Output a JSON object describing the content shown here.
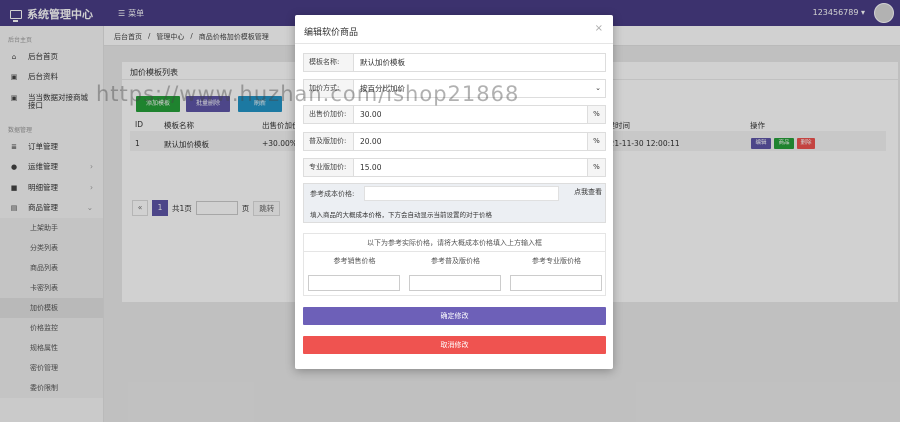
{
  "header": {
    "title": "系统管理中心",
    "menu_label": "菜单",
    "user": "123456789"
  },
  "sidebar": {
    "group1": "后台主页",
    "items1": [
      {
        "label": "后台首页"
      },
      {
        "label": "后台资料"
      },
      {
        "label": "当当数据对接商城接口"
      }
    ],
    "group2": "数据管理",
    "items2": [
      {
        "label": "订单管理"
      },
      {
        "label": "运维管理"
      },
      {
        "label": "明细管理"
      },
      {
        "label": "商品管理"
      }
    ],
    "subitems": [
      {
        "label": "上架助手"
      },
      {
        "label": "分类列表"
      },
      {
        "label": "商品列表"
      },
      {
        "label": "卡密列表"
      },
      {
        "label": "加价模板"
      },
      {
        "label": "价格监控"
      },
      {
        "label": "规格属性"
      },
      {
        "label": "密价管理"
      },
      {
        "label": "委价限制"
      }
    ]
  },
  "breadcrumb": [
    "后台首页",
    "管理中心",
    "商品价格加价模板管理"
  ],
  "panel": {
    "title": "加价模板列表",
    "toolbar": [
      "添加模板",
      "批量删除",
      "刷新"
    ],
    "columns": [
      "ID",
      "模板名称",
      "出售价加价",
      "创建时间",
      "操作"
    ],
    "row": {
      "id": "1",
      "name": "默认加价模板",
      "rate": "+30.00%",
      "time": "2021-11-30 12:00:11",
      "actions": [
        "编辑",
        "商品",
        "删除"
      ]
    },
    "pager": {
      "prev": "«",
      "page": "1",
      "total": "共1页",
      "unit": "页",
      "go": "跳转"
    }
  },
  "modal": {
    "title": "编辑软价商品",
    "close": "×",
    "fields": {
      "template_name": {
        "label": "模板名称:",
        "value": "默认加价模板"
      },
      "markup_mode": {
        "label": "加价方式:",
        "value": "按百分比加价"
      },
      "sale_markup": {
        "label": "出售价加价:",
        "value": "30.00",
        "unit": "%"
      },
      "normal_markup": {
        "label": "普及版加价:",
        "value": "20.00",
        "unit": "%"
      },
      "pro_markup": {
        "label": "专业版加价:",
        "value": "15.00",
        "unit": "%"
      }
    },
    "ref": {
      "label": "参考成本价格:",
      "button": "点我查看",
      "note": "填入商品的大概成本价格，下方会自动显示当前设置的对于价格"
    },
    "table": {
      "header": "以下为参考实际价格，请将大概成本价格填入上方输入框",
      "cols": [
        "参考销售价格",
        "参考普及版价格",
        "参考专业版价格"
      ]
    },
    "confirm": "确定修改",
    "cancel": "取消修改"
  },
  "watermark": "https://www.huzhan.com/ishop21868"
}
